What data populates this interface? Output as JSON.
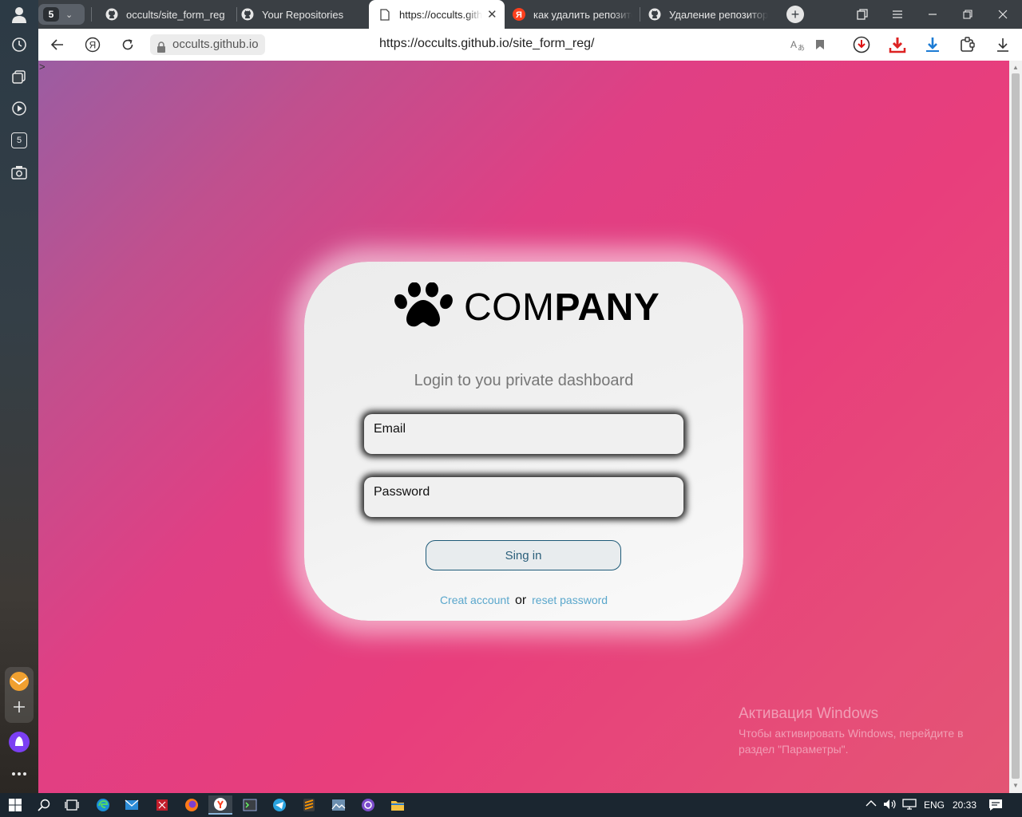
{
  "browser": {
    "tab_group_count": "5",
    "tabs": [
      {
        "label": "occults/site_form_reg",
        "icon": "github-icon"
      },
      {
        "label": "Your Repositories",
        "icon": "github-icon"
      },
      {
        "label": "https://occults.github",
        "icon": "page-icon",
        "active": true
      },
      {
        "label": "как удалить репозитор",
        "icon": "yandex-icon"
      },
      {
        "label": "Удаление репозитори",
        "icon": "github-icon"
      }
    ],
    "host": "occults.github.io",
    "url": "https://occults.github.io/site_form_reg/",
    "sidebar_tab_count": "5"
  },
  "page": {
    "stray_text": ">",
    "logo_text_light": "COM",
    "logo_text_bold": "PANY",
    "subtitle": "Login to you private dashboard",
    "email_placeholder": "Email",
    "password_placeholder": "Password",
    "signin_label": "Sing in",
    "create_account_link": "Creat account",
    "or_text": "or",
    "reset_password_link": "reset password"
  },
  "watermark": {
    "title": "Активация Windows",
    "text": "Чтобы активировать Windows, перейдите в раздел \"Параметры\"."
  },
  "taskbar": {
    "language": "ENG",
    "time": "20:33"
  },
  "colors": {
    "accent_link": "#5aa7cc",
    "gradient_pink": "#e83e7c",
    "gradient_purple": "#9b5da2"
  }
}
